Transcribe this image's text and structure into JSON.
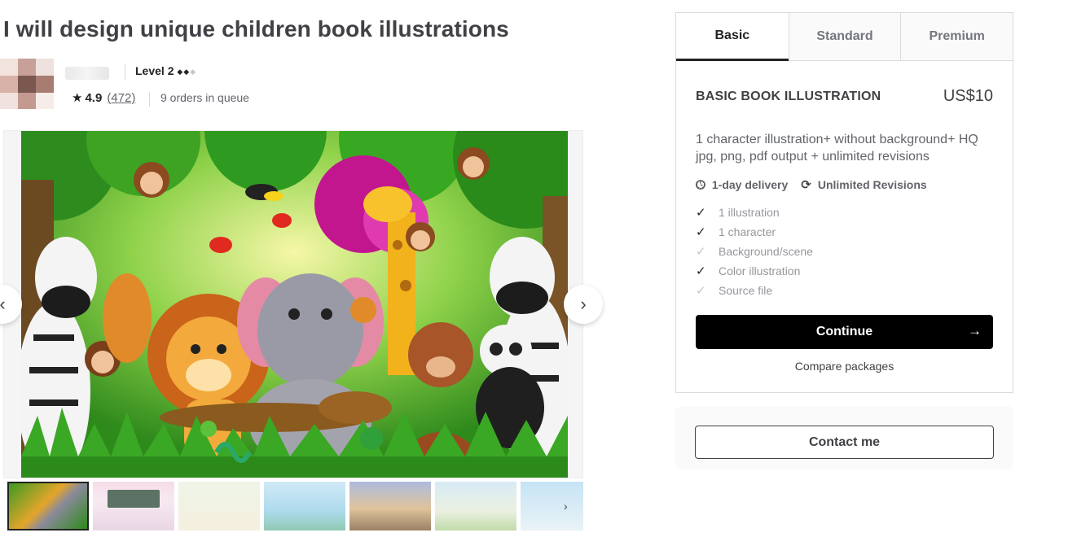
{
  "gig": {
    "title": "I will design unique children book illustrations"
  },
  "seller": {
    "level": "Level 2",
    "level_diamonds_filled": "◆◆",
    "level_diamonds_empty": "◆",
    "rating": "4.9",
    "reviews": "(472)",
    "queue": "9 orders in queue"
  },
  "gallery": {
    "prev_icon": "chevron-left-icon",
    "next_icon": "chevron-right-icon",
    "thumbs_next_icon": "chevron-right-icon",
    "thumbnail_count": 7
  },
  "package": {
    "tabs": [
      {
        "label": "Basic",
        "active": true
      },
      {
        "label": "Standard",
        "active": false
      },
      {
        "label": "Premium",
        "active": false
      }
    ],
    "name": "BASIC BOOK ILLUSTRATION",
    "price": "US$10",
    "description": "1 character illustration+ without background+ HQ jpg, png, pdf output + unlimited revisions",
    "delivery": "1-day delivery",
    "revisions": "Unlimited Revisions",
    "features": [
      {
        "label": "1 illustration",
        "included": true
      },
      {
        "label": "1 character",
        "included": true
      },
      {
        "label": "Background/scene",
        "included": false
      },
      {
        "label": "Color illustration",
        "included": true
      },
      {
        "label": "Source file",
        "included": false
      }
    ],
    "continue_label": "Continue",
    "compare_label": "Compare packages"
  },
  "contact": {
    "label": "Contact me"
  },
  "colors": {
    "text_dark": "#404145",
    "cta_bg": "#000000",
    "border": "#dadbdd"
  }
}
